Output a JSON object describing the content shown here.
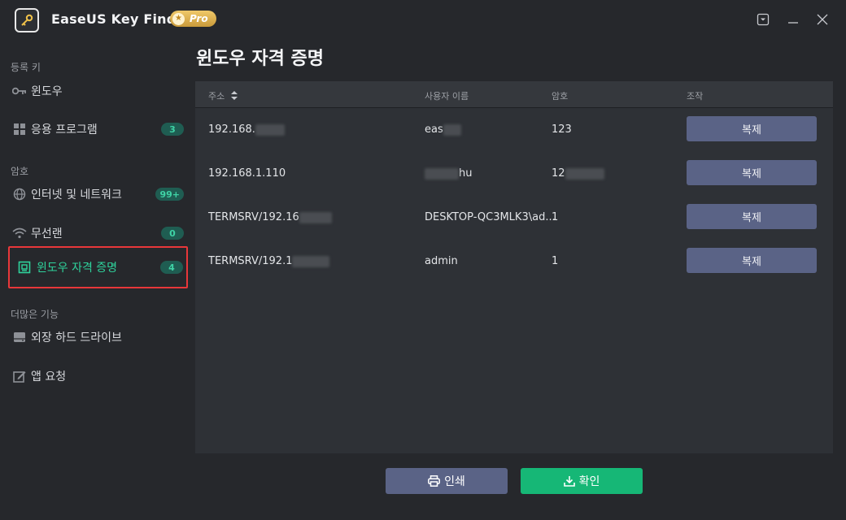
{
  "app": {
    "title": "EaseUS Key Finder",
    "badge": "Pro"
  },
  "sidebar": {
    "sections": [
      {
        "label": "등록 키"
      },
      {
        "label": "암호"
      },
      {
        "label": "더많은 기능"
      }
    ],
    "items": [
      {
        "label": "윈도우",
        "icon": "key-icon"
      },
      {
        "label": "응용 프로그램",
        "icon": "apps-grid-icon",
        "badge": "3"
      },
      {
        "label": "인터넷 및 네트워크",
        "icon": "globe-icon",
        "badge": "99+"
      },
      {
        "label": "무선랜",
        "icon": "wifi-icon",
        "badge": "0"
      },
      {
        "label": "윈도우 자격 증명",
        "icon": "credential-icon",
        "badge": "4"
      },
      {
        "label": "외장 하드 드라이브",
        "icon": "drive-icon"
      },
      {
        "label": "앱 요청",
        "icon": "edit-icon"
      }
    ]
  },
  "main": {
    "title": "윈도우 자격 증명",
    "columns": [
      "주소",
      "사용자 이름",
      "암호",
      "조작"
    ],
    "rows": [
      {
        "address": "192.168.",
        "username": "eas",
        "password": "123",
        "action": "복제"
      },
      {
        "address": "192.168.1.110",
        "username": "hu",
        "password": "12",
        "action": "복제"
      },
      {
        "address": "TERMSRV/192.16",
        "username": "DESKTOP-QC3MLK3\\ad...",
        "password": "1",
        "action": "복제"
      },
      {
        "address": "TERMSRV/192.1",
        "username": "admin",
        "password": "1",
        "action": "복제"
      }
    ]
  },
  "footer": {
    "print_label": "인쇄",
    "ok_label": "확인"
  },
  "colors": {
    "accent": "#16b776",
    "active_text": "#2fd39c",
    "button": "#5a6386",
    "highlight_border": "#e8373a"
  }
}
